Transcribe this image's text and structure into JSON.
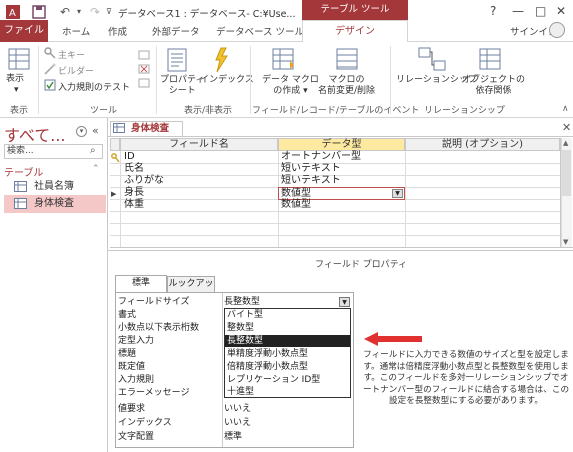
{
  "title": "データベース1 : データベース- C:¥Use...",
  "context_tab": "テーブル ツール",
  "window_buttons": [
    "?",
    "—",
    "□",
    "✕"
  ],
  "tabs": [
    "ファイル",
    "ホーム",
    "作成",
    "外部データ",
    "データベース ツール",
    "デザイン"
  ],
  "signin": "サインイン",
  "ribbon": {
    "view_label": "表示",
    "group_view": "表示",
    "primary_key": "主キー",
    "builder": "ビルダー",
    "test_rules": "入力規則のテスト",
    "group_tools": "ツール",
    "property_sheet": [
      "プロパティ",
      "シート"
    ],
    "indexes": "インデックス",
    "group_show_hide": "表示/非表示",
    "data_macro": [
      "データ マクロ",
      "の作成 ▾"
    ],
    "macro_rename": [
      "マクロの",
      "名前変更/削除"
    ],
    "group_events": "フィールド/レコード/テーブルのイベント",
    "relationships": "リレーションシップ",
    "object_deps": [
      "オブジェクトの",
      "依存関係"
    ],
    "group_relationships": "リレーションシップ"
  },
  "nav": {
    "title": "すべて...",
    "search_placeholder": "検索...",
    "category": "テーブル",
    "items": [
      "社員名簿",
      "身体検査"
    ]
  },
  "doc_tab": "身体検査",
  "grid": {
    "headers": [
      "フィールド名",
      "データ型",
      "説明 (オプション)"
    ],
    "rows": [
      {
        "name": "ID",
        "type": "オートナンバー型",
        "key": true
      },
      {
        "name": "氏名",
        "type": "短いテキスト"
      },
      {
        "name": "ふりがな",
        "type": "短いテキスト"
      },
      {
        "name": "身長",
        "type": "数値型",
        "selected": true
      },
      {
        "name": "体重",
        "type": "数値型"
      }
    ]
  },
  "props_caption": "フィールド プロパティ",
  "prop_tabs": [
    "標準",
    "ルックアップ"
  ],
  "properties": [
    {
      "label": "フィールドサイズ",
      "value": "長整数型"
    },
    {
      "label": "書式",
      "value": ""
    },
    {
      "label": "小数点以下表示桁数",
      "value": ""
    },
    {
      "label": "定型入力",
      "value": ""
    },
    {
      "label": "標題",
      "value": ""
    },
    {
      "label": "既定値",
      "value": ""
    },
    {
      "label": "入力規則",
      "value": ""
    },
    {
      "label": "エラーメッセージ",
      "value": ""
    },
    {
      "label": "値要求",
      "value": "いいえ"
    },
    {
      "label": "インデックス",
      "value": "いいえ"
    },
    {
      "label": "文字配置",
      "value": "標準"
    }
  ],
  "dropdown": {
    "selected": "長整数型",
    "options": [
      "バイト型",
      "整数型",
      "長整数型",
      "単精度浮動小数点型",
      "倍精度浮動小数点型",
      "レプリケーション ID型",
      "十進型"
    ],
    "highlight_index": 2
  },
  "hint": "フィールドに入力できる数値のサイズと型を設定します。通常は倍精度浮動小数点型と長整数型を使用します。このフィールドを多対一リレーションシップでオートナンバー型のフィールドに結合する場合は、この設定を長整数型にする必要があります。",
  "colors": {
    "accent": "#a4373a",
    "arrow": "#e03030",
    "selection": "#222222"
  }
}
